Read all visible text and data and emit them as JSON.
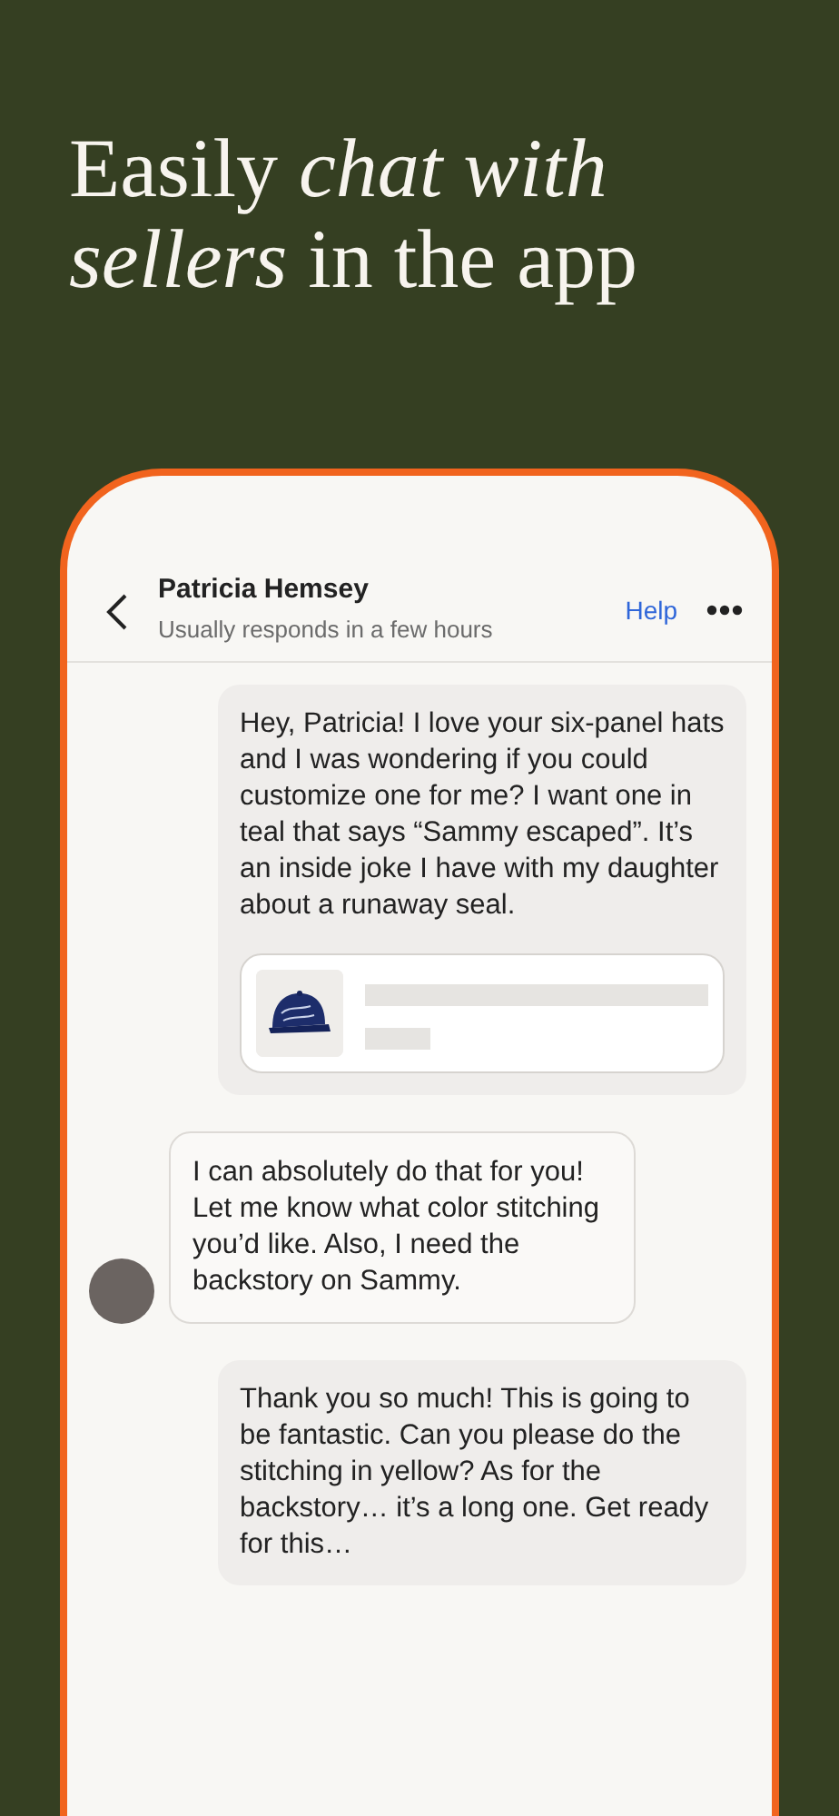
{
  "headline": "Easily *chat with sellers* in the app",
  "chat_header": {
    "name": "Patricia Hemsey",
    "subtitle": "Usually responds in a few hours",
    "help": "Help"
  },
  "messages": [
    {
      "kind": "sent",
      "text": "Hey, Patricia! I love your six-panel hats and I was wondering if you could customize one for me? I want one in teal that says “Sammy escaped”. It’s an inside joke I have with my daughter about a runaway seal."
    },
    {
      "kind": "received",
      "text": "I can absolutely do that for you! Let me know what color stitching you’d like. Also, I need the backstory on Sammy."
    },
    {
      "kind": "sent",
      "text": "Thank you so much! This is going to be fantastic. Can you please do the stitching in yellow? As for the backstory… it’s a long one. Get ready for this…"
    }
  ]
}
